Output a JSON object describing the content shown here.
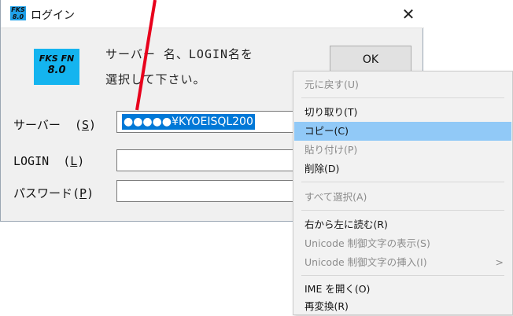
{
  "window": {
    "title": "ログイン",
    "icon_text": "FKS FN 8.0",
    "close_glyph": "✕"
  },
  "logo": {
    "line1": "FKS FN",
    "line2": "8.0",
    "color": "#14b4ef"
  },
  "instruction": {
    "line1": "サーバー 名、LOGIN名を",
    "line2": "選択して下さい。"
  },
  "ok_button": {
    "label": "OK"
  },
  "fields": {
    "server": {
      "label_pre": "サーバー  (",
      "mnemonic": "S",
      "label_post": ")",
      "value": "●●●●●¥KYOEISQL200"
    },
    "login": {
      "label_pre": "LOGIN  (",
      "mnemonic": "L",
      "label_post": ")",
      "value": ""
    },
    "password": {
      "label_pre": "パスワード(",
      "mnemonic": "P",
      "label_post": ")",
      "value": ""
    }
  },
  "context_menu": {
    "items": [
      {
        "label": "元に戻す(U)",
        "disabled": true
      },
      {
        "label": "切り取り(T)",
        "disabled": false
      },
      {
        "label": "コピー(C)",
        "disabled": false,
        "highlighted": true
      },
      {
        "label": "貼り付け(P)",
        "disabled": true
      },
      {
        "label": "削除(D)",
        "disabled": false
      },
      {
        "label": "すべて選択(A)",
        "disabled": true
      },
      {
        "label": "右から左に読む(R)",
        "disabled": false
      },
      {
        "label": "Unicode 制御文字の表示(S)",
        "disabled": true
      },
      {
        "label": "Unicode 制御文字の挿入(I)",
        "disabled": true,
        "submenu_glyph": ">"
      },
      {
        "label": "IME を開く(O)",
        "disabled": false
      },
      {
        "label": "再変換(R)",
        "disabled": false
      }
    ]
  },
  "colors": {
    "highlight": "#91c9f7",
    "selection": "#0078d7",
    "pointer": "#e8001c"
  }
}
